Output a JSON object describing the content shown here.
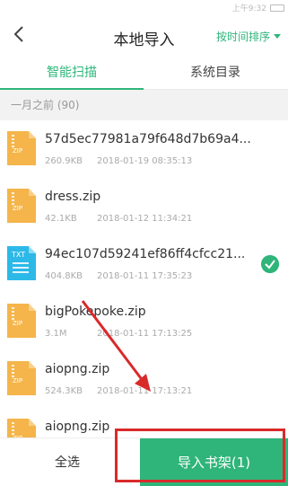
{
  "status": {
    "time_text": "上午9:32"
  },
  "header": {
    "title": "本地导入",
    "sort_label": "按时间排序"
  },
  "tabs": [
    {
      "label": "智能扫描"
    },
    {
      "label": "系统目录"
    }
  ],
  "section": {
    "label": "一月之前 (90)"
  },
  "files": [
    {
      "name": "57d5ec77981a79f648d7b69a4...",
      "size": "260.9KB",
      "date": "2018-01-19 08:35:13",
      "type": "zip",
      "selected": false
    },
    {
      "name": "dress.zip",
      "size": "42.1KB",
      "date": "2018-01-12 11:34:21",
      "type": "zip",
      "selected": false
    },
    {
      "name": "94ec107d59241ef86ff4cfcc21...",
      "size": "404.8KB",
      "date": "2018-01-11 17:35:23",
      "type": "txt",
      "selected": true
    },
    {
      "name": "bigPokepoke.zip",
      "size": "3.1M",
      "date": "2018-01-11 17:13:25",
      "type": "zip",
      "selected": false
    },
    {
      "name": "aiopng.zip",
      "size": "524.3KB",
      "date": "2018-01-11 17:13:21",
      "type": "zip",
      "selected": false
    },
    {
      "name": "aiopng.zip",
      "size": "",
      "date": "",
      "type": "zip",
      "selected": false
    }
  ],
  "bottom": {
    "select_all": "全选",
    "import_label": "导入书架(1)"
  },
  "icons": {
    "file_zip_label": "ZIP",
    "file_txt_label": "TXT"
  },
  "colors": {
    "accent": "#2fb57a",
    "zip": "#f5b54a",
    "txt": "#2cb9e8",
    "annotation": "#d92a2a"
  }
}
